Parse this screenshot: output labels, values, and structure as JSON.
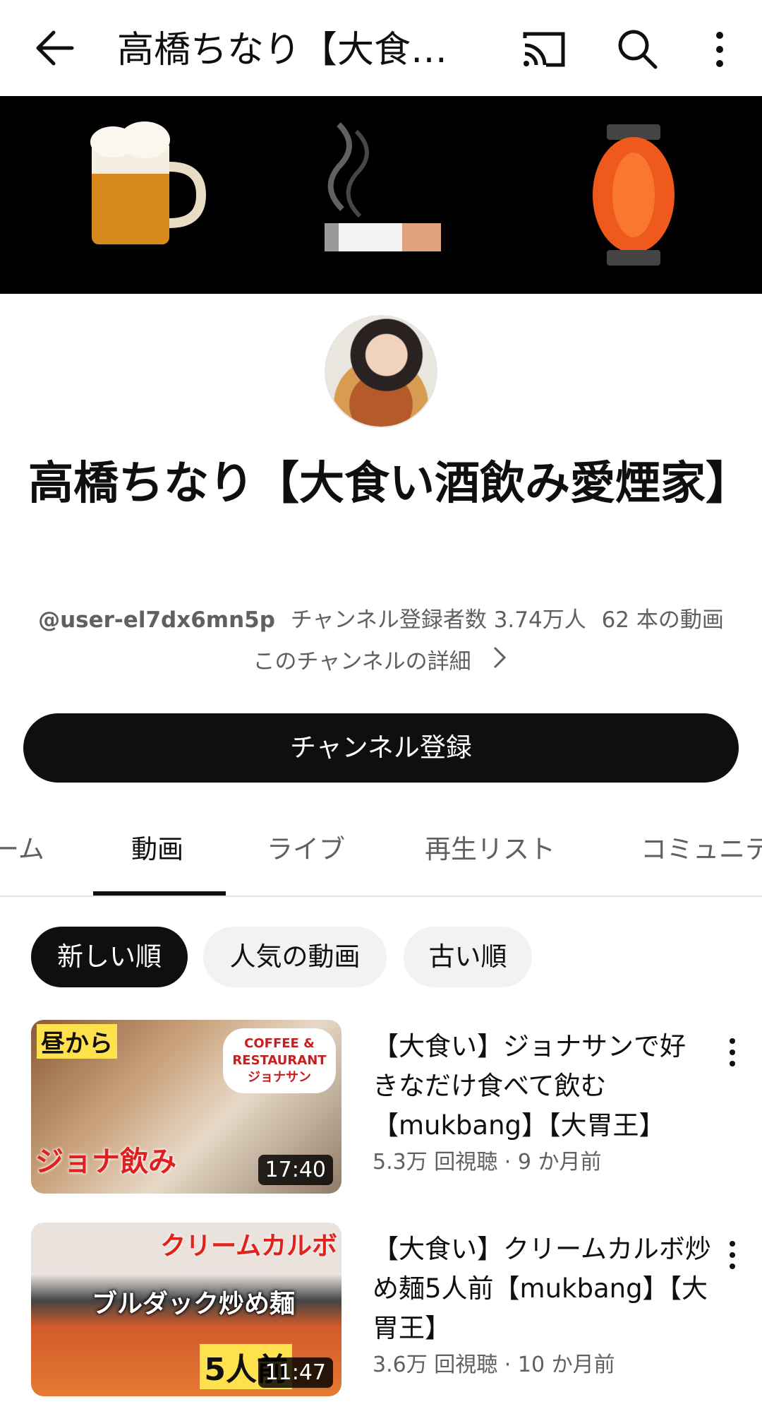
{
  "appbar": {
    "title": "高橋ちなり【大食…",
    "icons": [
      "back-arrow-icon",
      "cast-icon",
      "search-icon",
      "more-vert-icon"
    ]
  },
  "banner": {
    "emojis": [
      "🍺",
      "🚬",
      "🏮"
    ]
  },
  "channel": {
    "name": "高橋ちなり【大食い酒飲み愛煙家】",
    "handle": "@user-el7dx6mn5p",
    "subscribers": "チャンネル登録者数 3.74万人",
    "video_count": "62 本の動画",
    "details_label": "このチャンネルの詳細",
    "subscribe_label": "チャンネル登録"
  },
  "tabs": [
    {
      "label": "ーム",
      "active": false
    },
    {
      "label": "動画",
      "active": true
    },
    {
      "label": "ライブ",
      "active": false
    },
    {
      "label": "再生リスト",
      "active": false
    },
    {
      "label": "コミュニテ",
      "active": false
    }
  ],
  "chips": [
    {
      "label": "新しい順",
      "selected": true
    },
    {
      "label": "人気の動画",
      "selected": false
    },
    {
      "label": "古い順",
      "selected": false
    }
  ],
  "videos": [
    {
      "title": "【大食い】ジョナサンで好きなだけ食べて飲む【mukbang】【大胃王】",
      "meta": "5.3万 回視聴 · 9 か月前",
      "duration": "17:40",
      "thumb_captions": [
        "昼から",
        "ジョナ飲み",
        "COFFEE & RESTAURANT ジョナサン"
      ]
    },
    {
      "title": "【大食い】クリームカルボ炒め麺5人前【mukbang】【大胃王】",
      "meta": "3.6万 回視聴 · 10 か月前",
      "duration": "11:47",
      "thumb_captions": [
        "クリームカルボ",
        "ブルダック炒め麺",
        "5人前"
      ]
    }
  ]
}
